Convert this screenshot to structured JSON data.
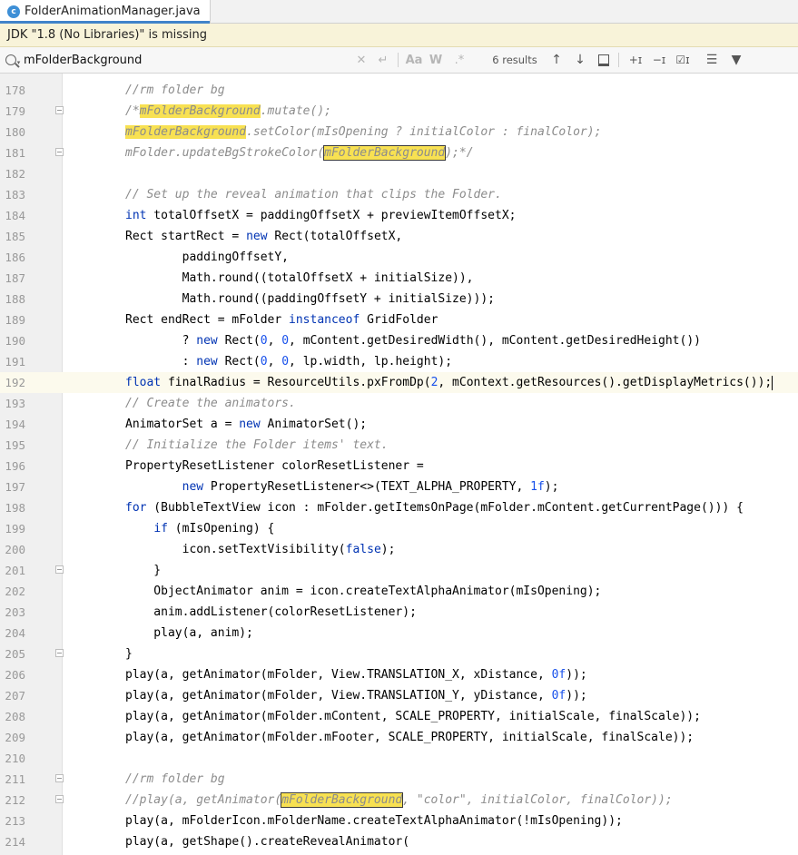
{
  "tab": {
    "icon_letter": "c",
    "title": "FolderAnimationManager.java"
  },
  "banner": {
    "text": "JDK \"1.8 (No Libraries)\" is missing"
  },
  "search": {
    "query": "mFolderBackground",
    "match_case": "Aa",
    "words": "W",
    "regex": ".*",
    "results": "6 results"
  },
  "icons": [
    "search-icon",
    "clear-icon",
    "new-line-icon",
    "up-arrow-icon",
    "down-arrow-icon",
    "select-all-icon",
    "add-occurrence-icon",
    "remove-occurrence-icon",
    "select-all-occurrences-icon",
    "filter-icon",
    "funnel-icon"
  ],
  "editor": {
    "current_line": 192,
    "lines": [
      {
        "n": "178",
        "text": "    //rm folder bg"
      },
      {
        "n": "179",
        "text": "    /*mFolderBackground.mutate();"
      },
      {
        "n": "180",
        "text": "    mFolderBackground.setColor(mIsOpening ? initialColor : finalColor);"
      },
      {
        "n": "181",
        "text": "    mFolder.updateBgStrokeColor(mFolderBackground);*/"
      },
      {
        "n": "182",
        "text": ""
      },
      {
        "n": "183",
        "text": "    // Set up the reveal animation that clips the Folder."
      },
      {
        "n": "184",
        "text": "    int totalOffsetX = paddingOffsetX + previewItemOffsetX;"
      },
      {
        "n": "185",
        "text": "    Rect startRect = new Rect(totalOffsetX,"
      },
      {
        "n": "186",
        "text": "            paddingOffsetY,"
      },
      {
        "n": "187",
        "text": "            Math.round((totalOffsetX + initialSize)),"
      },
      {
        "n": "188",
        "text": "            Math.round((paddingOffsetY + initialSize)));"
      },
      {
        "n": "189",
        "text": "    Rect endRect = mFolder instanceof GridFolder"
      },
      {
        "n": "190",
        "text": "            ? new Rect(0, 0, mContent.getDesiredWidth(), mContent.getDesiredHeight())"
      },
      {
        "n": "191",
        "text": "            : new Rect(0, 0, lp.width, lp.height);"
      },
      {
        "n": "192",
        "text": "    float finalRadius = ResourceUtils.pxFromDp(2, mContext.getResources().getDisplayMetrics());"
      },
      {
        "n": "193",
        "text": "    // Create the animators."
      },
      {
        "n": "194",
        "text": "    AnimatorSet a = new AnimatorSet();"
      },
      {
        "n": "195",
        "text": "    // Initialize the Folder items' text."
      },
      {
        "n": "196",
        "text": "    PropertyResetListener colorResetListener ="
      },
      {
        "n": "197",
        "text": "            new PropertyResetListener<>(TEXT_ALPHA_PROPERTY, 1f);"
      },
      {
        "n": "198",
        "text": "    for (BubbleTextView icon : mFolder.getItemsOnPage(mFolder.mContent.getCurrentPage())) {"
      },
      {
        "n": "199",
        "text": "        if (mIsOpening) {"
      },
      {
        "n": "200",
        "text": "            icon.setTextVisibility(false);"
      },
      {
        "n": "201",
        "text": "        }"
      },
      {
        "n": "202",
        "text": "        ObjectAnimator anim = icon.createTextAlphaAnimator(mIsOpening);"
      },
      {
        "n": "203",
        "text": "        anim.addListener(colorResetListener);"
      },
      {
        "n": "204",
        "text": "        play(a, anim);"
      },
      {
        "n": "205",
        "text": "    }"
      },
      {
        "n": "206",
        "text": "    play(a, getAnimator(mFolder, View.TRANSLATION_X, xDistance, 0f));"
      },
      {
        "n": "207",
        "text": "    play(a, getAnimator(mFolder, View.TRANSLATION_Y, yDistance, 0f));"
      },
      {
        "n": "208",
        "text": "    play(a, getAnimator(mFolder.mContent, SCALE_PROPERTY, initialScale, finalScale));"
      },
      {
        "n": "209",
        "text": "    play(a, getAnimator(mFolder.mFooter, SCALE_PROPERTY, initialScale, finalScale));"
      },
      {
        "n": "210",
        "text": ""
      },
      {
        "n": "211",
        "text": "    //rm folder bg"
      },
      {
        "n": "212",
        "text": "    //play(a, getAnimator(mFolderBackground, \"color\", initialColor, finalColor));"
      },
      {
        "n": "213",
        "text": "    play(a, mFolderIcon.mFolderName.createTextAlphaAnimator(!mIsOpening));"
      },
      {
        "n": "214",
        "text": "    play(a, getShape().createRevealAnimator("
      }
    ]
  }
}
